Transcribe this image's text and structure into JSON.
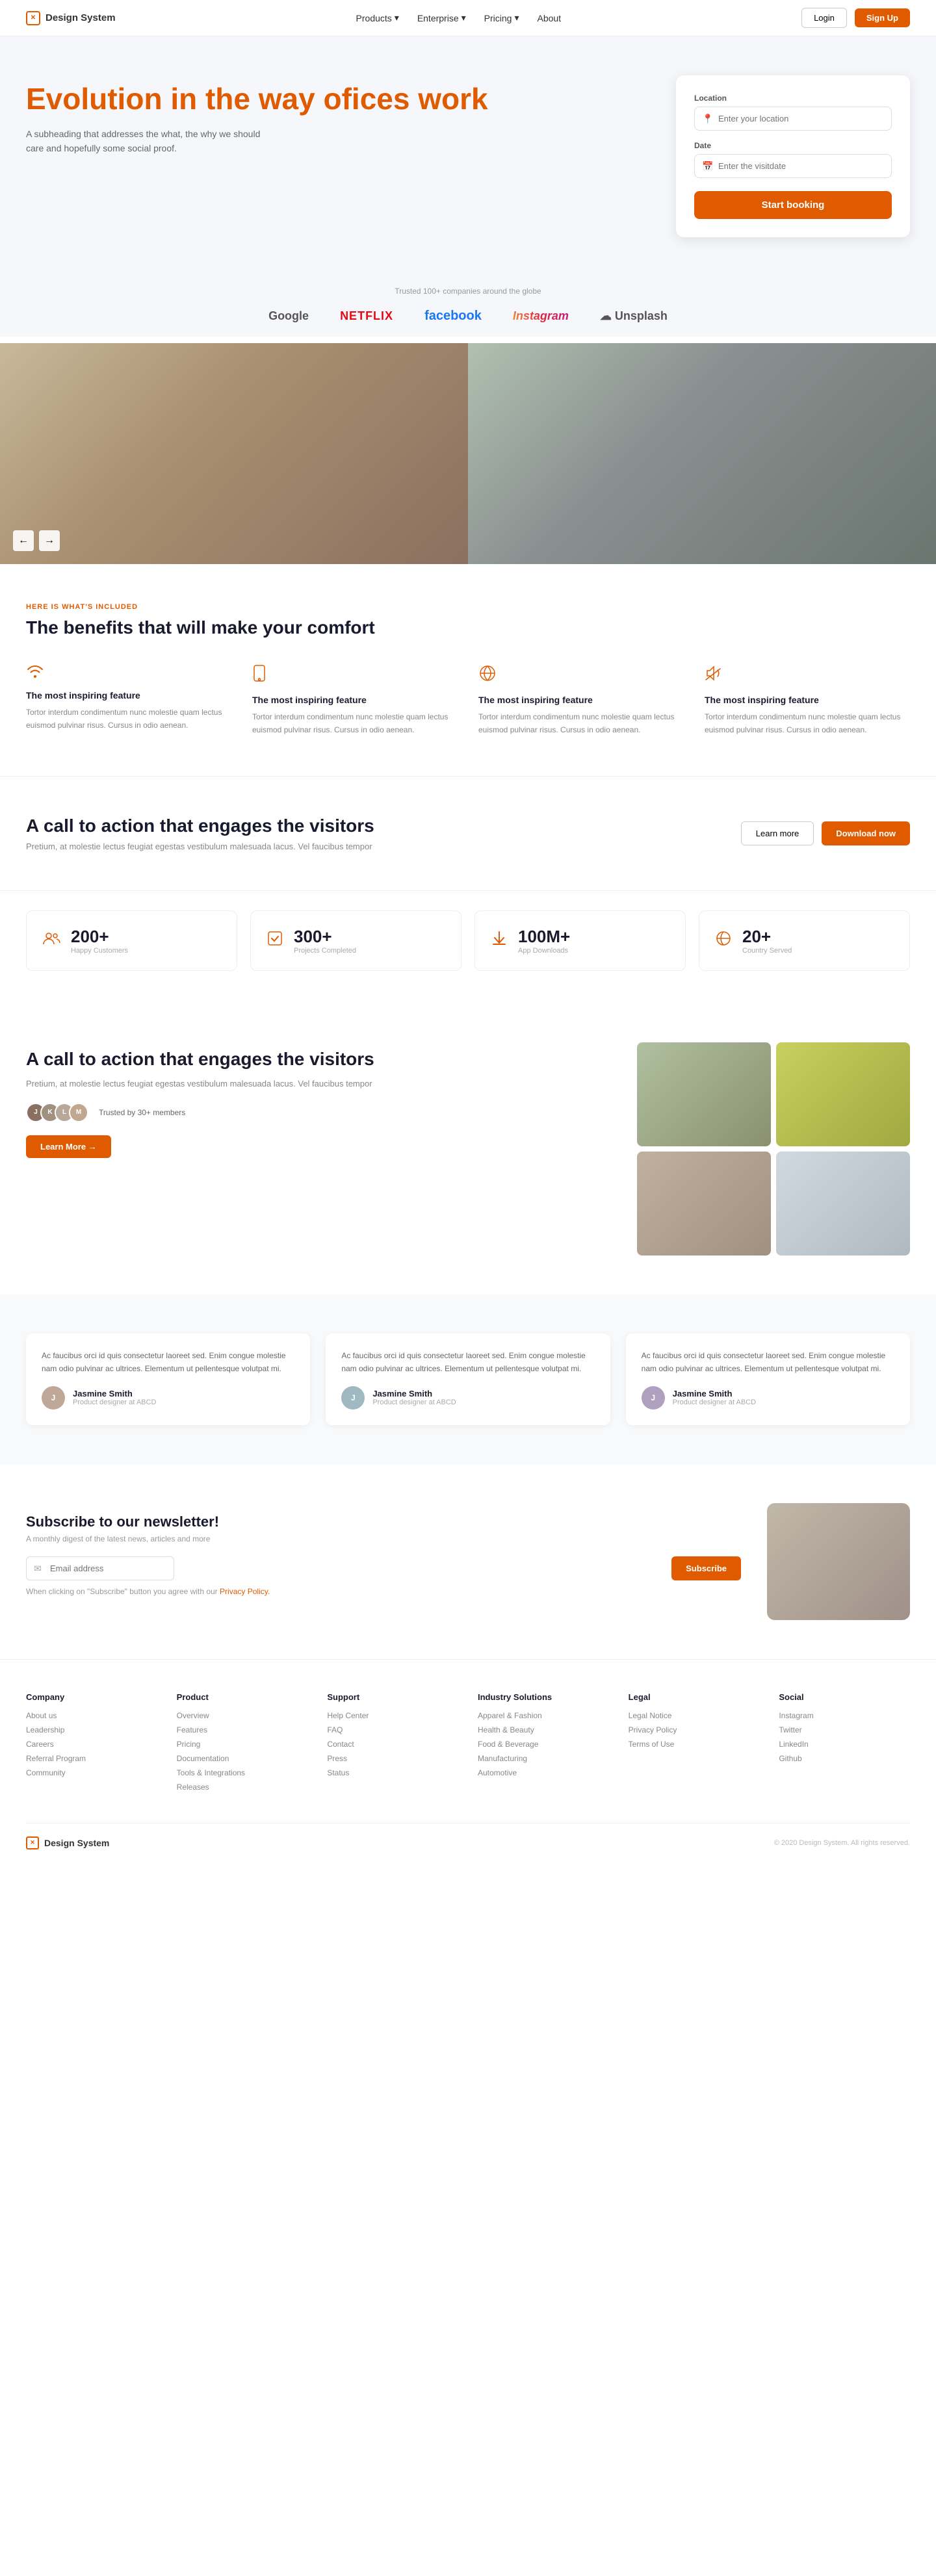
{
  "brand": {
    "name": "Design System",
    "icon": "✕"
  },
  "nav": {
    "links": [
      {
        "label": "Products",
        "has_dropdown": true
      },
      {
        "label": "Enterprise",
        "has_dropdown": true
      },
      {
        "label": "Pricing",
        "has_dropdown": true
      },
      {
        "label": "About",
        "has_dropdown": false
      }
    ],
    "login_label": "Login",
    "signup_label": "Sign Up"
  },
  "hero": {
    "title_highlight": "Evolution",
    "title_rest": " in the way ofices work",
    "subtitle": "A subheading that addresses the what, the why we should care and hopefully some social proof.",
    "booking_card": {
      "location_label": "Location",
      "location_placeholder": "Enter your location",
      "date_label": "Date",
      "date_placeholder": "Enter the visitdate",
      "book_button": "Start booking"
    }
  },
  "trusted": {
    "text": "Trusted 100+ companies around the globe",
    "logos": [
      "Google",
      "NETFLIX",
      "facebook",
      "Instagram",
      "Unsplash"
    ]
  },
  "gallery": {
    "prev_label": "←",
    "next_label": "→"
  },
  "benefits": {
    "tag": "HERE IS WHAT'S included",
    "title": "The benefits that will make your comfort",
    "features": [
      {
        "icon": "wifi",
        "name": "The most inspiring feature",
        "desc": "Tortor interdum condimentum nunc molestie quam lectus euismod pulvinar risus. Cursus in odio aenean."
      },
      {
        "icon": "phone",
        "name": "The most inspiring feature",
        "desc": "Tortor interdum condimentum nunc molestie quam lectus euismod pulvinar risus. Cursus in odio aenean."
      },
      {
        "icon": "globe",
        "name": "The most inspiring feature",
        "desc": "Tortor interdum condimentum nunc molestie quam lectus euismod pulvinar risus. Cursus in odio aenean."
      },
      {
        "icon": "volume",
        "name": "The most inspiring feature",
        "desc": "Tortor interdum condimentum nunc molestie quam lectus euismod pulvinar risus. Cursus in odio aenean."
      }
    ]
  },
  "cta_band": {
    "title": "A call to action that engages the visitors",
    "subtitle": "Pretium, at molestie lectus feugiat egestas vestibulum malesuada lacus. Vel faucibus tempor",
    "learn_label": "Learn more",
    "download_label": "Download now"
  },
  "stats": [
    {
      "icon": "👥",
      "number": "200+",
      "label": "Happy Customers"
    },
    {
      "icon": "✅",
      "number": "300+",
      "label": "Projects Completed"
    },
    {
      "icon": "⬇",
      "number": "100M+",
      "label": "App Downloads"
    },
    {
      "icon": "🌐",
      "number": "20+",
      "label": "Country Served"
    }
  ],
  "cta_section": {
    "title": "A call to action that engages the visitors",
    "subtitle": "Pretium, at molestie lectus feugiat egestas vestibulum malesuada lacus. Vel faucibus tempor",
    "members_text": "Trusted by 30+ members",
    "learn_label": "Learn More →"
  },
  "testimonials": [
    {
      "text": "Ac faucibus orci id quis consectetur laoreet sed. Enim congue molestie nam odio pulvinar ac ultrices. Elementum ut pellentesque volutpat mi.",
      "name": "Jasmine Smith",
      "title": "Product designer at ABCD"
    },
    {
      "text": "Ac faucibus orci id quis consectetur laoreet sed. Enim congue molestie nam odio pulvinar ac ultrices. Elementum ut pellentesque volutpat mi.",
      "name": "Jasmine Smith",
      "title": "Product designer at ABCD"
    },
    {
      "text": "Ac faucibus orci id quis consectetur laoreet sed. Enim congue molestie nam odio pulvinar ac ultrices. Elementum ut pellentesque volutpat mi.",
      "name": "Jasmine Smith",
      "title": "Product designer at ABCD"
    }
  ],
  "newsletter": {
    "title": "Subscribe to our newsletter!",
    "subtitle": "A monthly digest of the latest news, articles and more",
    "email_placeholder": "Email address",
    "subscribe_label": "Subscribe",
    "privacy_note": "When clicking on \"Subscribe\" button you agree with our",
    "privacy_link": "Privacy Policy."
  },
  "footer": {
    "columns": [
      {
        "heading": "Company",
        "links": [
          "About us",
          "Leadership",
          "Careers",
          "Referral Program",
          "Community"
        ]
      },
      {
        "heading": "Product",
        "links": [
          "Overview",
          "Features",
          "Pricing",
          "Documentation",
          "Tools & Integrations",
          "Releases"
        ]
      },
      {
        "heading": "Support",
        "links": [
          "Help Center",
          "FAQ",
          "Contact",
          "Press",
          "Status"
        ]
      },
      {
        "heading": "Industry Solutions",
        "links": [
          "Apparel & Fashion",
          "Health & Beauty",
          "Food & Beverage",
          "Manufacturing",
          "Automotive"
        ]
      },
      {
        "heading": "Legal",
        "links": [
          "Legal Notice",
          "Privacy Policy",
          "Terms of Use"
        ]
      },
      {
        "heading": "Social",
        "links": [
          "Instagram",
          "Twitter",
          "LinkedIn",
          "Github"
        ]
      }
    ],
    "copyright": "© 2020 Design System. All rights reserved."
  }
}
